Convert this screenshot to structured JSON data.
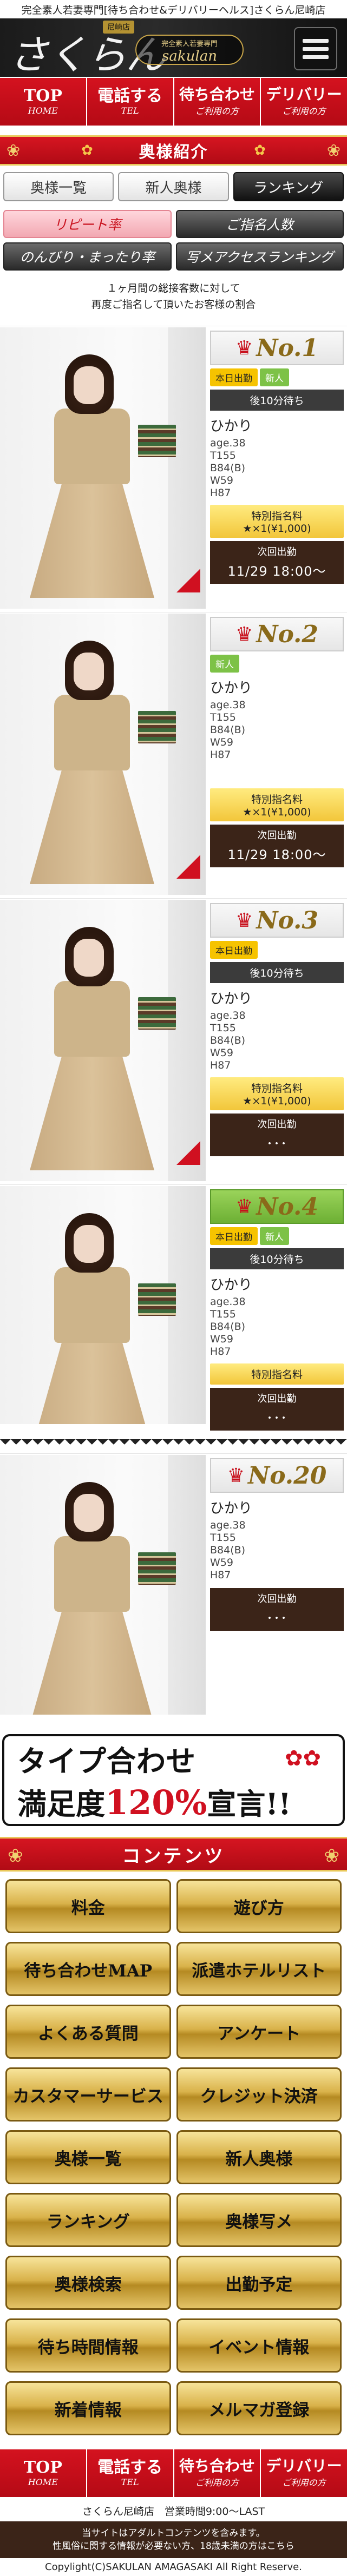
{
  "top_strip": "完全素人若妻専門[待ち合わせ&デリバリーヘルス]さくらん尼崎店",
  "header": {
    "logo_kana": "さくらん",
    "logo_area": "尼崎店",
    "logo_sub1": "完全素人若妻専門",
    "logo_sub2": "sakulan",
    "menu_icon": "hamburger-menu-icon"
  },
  "nav": [
    {
      "main": "TOP",
      "sub": "HOME"
    },
    {
      "main": "電話する",
      "sub": "TEL"
    },
    {
      "main": "待ち合わせ",
      "sub": "ご利用の方"
    },
    {
      "main": "デリバリー",
      "sub": "ご利用の方"
    }
  ],
  "section_title": "奥様紹介",
  "tabs": [
    "奥様一覧",
    "新人奥様",
    "ランキング"
  ],
  "subtabs": [
    "リピート率",
    "ご指名人数",
    "のんびり・まったり率",
    "写メアクセスランキング"
  ],
  "description": {
    "line1": "１ヶ月間の総接客数に対して",
    "line2": "再度ご指名して頂いたお客様の割合"
  },
  "cards": [
    {
      "rank": "No.1",
      "tags": [
        "本日出勤",
        "新人"
      ],
      "wait": "後10分待ち",
      "name": "ひかり",
      "age": "age.38",
      "t": "T155",
      "b": "B84(B)",
      "w": "W59",
      "h": "H87",
      "special_label": "特別指名料",
      "special_value": "★×1(¥1,000)",
      "next_label": "次回出勤",
      "next_value": "11/29 18:00～"
    },
    {
      "rank": "No.2",
      "tags": [
        "新人"
      ],
      "wait": "",
      "name": "ひかり",
      "age": "age.38",
      "t": "T155",
      "b": "B84(B)",
      "w": "W59",
      "h": "H87",
      "special_label": "特別指名料",
      "special_value": "★×1(¥1,000)",
      "next_label": "次回出勤",
      "next_value": "11/29 18:00～"
    },
    {
      "rank": "No.3",
      "tags": [
        "本日出勤"
      ],
      "wait": "後10分待ち",
      "name": "ひかり",
      "age": "age.38",
      "t": "T155",
      "b": "B84(B)",
      "w": "W59",
      "h": "H87",
      "special_label": "特別指名料",
      "special_value": "★×1(¥1,000)",
      "next_label": "次回出勤",
      "next_value": "･･･"
    },
    {
      "rank": "No.4",
      "tags": [
        "本日出勤",
        "新人"
      ],
      "wait": "後10分待ち",
      "name": "ひかり",
      "age": "age.38",
      "t": "T155",
      "b": "B84(B)",
      "w": "W59",
      "h": "H87",
      "special_label": "特別指名料",
      "special_value": "",
      "next_label": "次回出勤",
      "next_value": "･･･"
    },
    {
      "rank": "No.20",
      "tags": [],
      "wait": "",
      "name": "ひかり",
      "age": "age.38",
      "t": "T155",
      "b": "B84(B)",
      "w": "W59",
      "h": "H87",
      "special_label": "",
      "special_value": "",
      "next_label": "次回出勤",
      "next_value": "･･･"
    }
  ],
  "banner": {
    "line1": "タイプ合わせ",
    "line2a": "満足度",
    "line2b": "120%",
    "line2c": "宣言!!"
  },
  "contents_title": "コンテンツ",
  "contents": [
    "料金",
    "遊び方",
    "待ち合わせMAP",
    "派遣ホテルリスト",
    "よくある質問",
    "アンケート",
    "カスタマーサービス",
    "クレジット決済",
    "奥様一覧",
    "新人奥様",
    "ランキング",
    "奥様写メ",
    "奥様検索",
    "出勤予定",
    "待ち時間情報",
    "イベント情報",
    "新着情報",
    "メルマガ登録"
  ],
  "shop_line": "さくらん尼崎店　営業時間9:00～LAST",
  "footer": {
    "disc1": "当サイトはアダルトコンテンツを含みます。",
    "disc2": "性風俗に関する情報が必要ない方、18歳未満の方はこちら",
    "copyright": "Copylight(C)SAKULAN AMAGASAKI All Right Reserve."
  },
  "colors": {
    "brand_red": "#c8101c",
    "gold": "#d9b24a",
    "dark_brown": "#3b2418"
  }
}
